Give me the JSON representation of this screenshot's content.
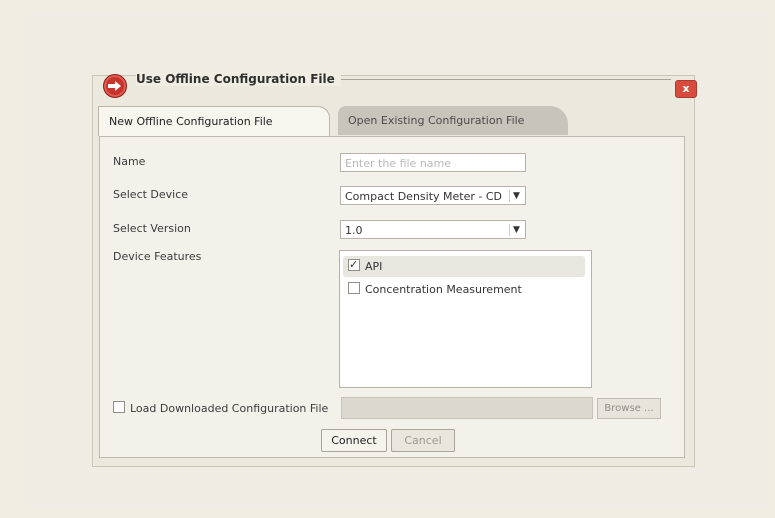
{
  "dialog": {
    "title": "Use Offline Configuration File",
    "close_label": "x"
  },
  "tabs": {
    "new_label": "New Offline Configuration File",
    "open_label": "Open Existing Configuration File"
  },
  "form": {
    "name_label": "Name",
    "name_placeholder": "Enter the file name",
    "device_label": "Select Device",
    "device_value": "Compact Density Meter - CD",
    "version_label": "Select Version",
    "version_value": "1.0",
    "features_label": "Device Features",
    "features": [
      {
        "label": "API",
        "checked": true
      },
      {
        "label": "Concentration Measurement",
        "checked": false
      }
    ],
    "load_label": "Load Downloaded Configuration File",
    "browse_label": "Browse ..."
  },
  "actions": {
    "connect_label": "Connect",
    "cancel_label": "Cancel"
  },
  "colors": {
    "accent_red": "#c7342c",
    "background": "#f0eee3"
  },
  "icons": {
    "title_icon": "arrow-right-icon"
  }
}
